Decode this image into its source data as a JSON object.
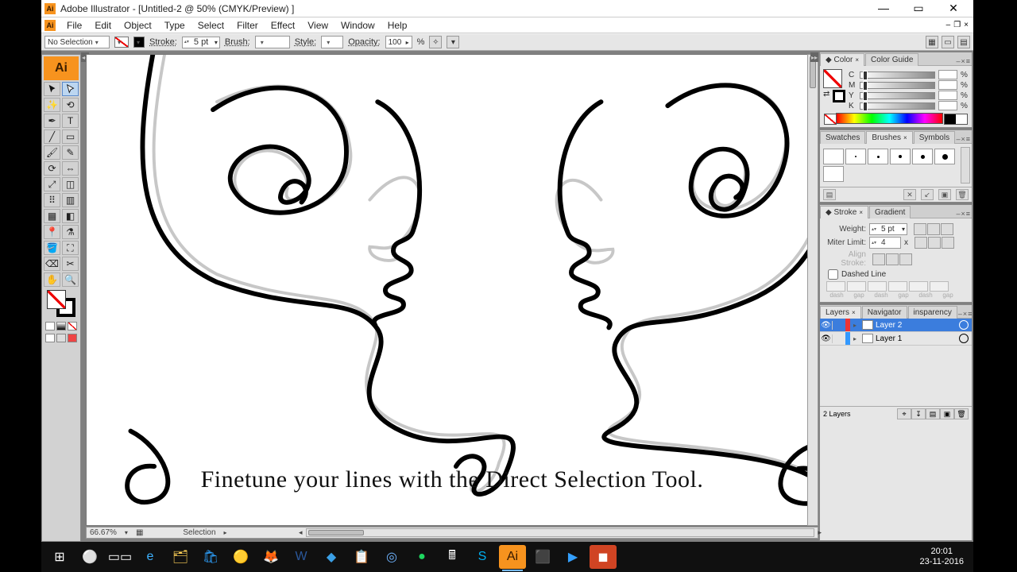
{
  "title": "Adobe Illustrator - [Untitled-2 @ 50% (CMYK/Preview) ]",
  "menu": [
    "File",
    "Edit",
    "Object",
    "Type",
    "Select",
    "Filter",
    "Effect",
    "View",
    "Window",
    "Help"
  ],
  "optbar": {
    "selection": "No Selection",
    "stroke_label": "Stroke:",
    "stroke_weight": "5 pt",
    "brush_label": "Brush:",
    "style_label": "Style:",
    "opacity_label": "Opacity:",
    "opacity": "100",
    "pct": "%"
  },
  "status": {
    "zoom": "66.67%",
    "tool": "Selection"
  },
  "caption": "Finetune  your lines with the Direct Selection Tool.",
  "panels": {
    "color": {
      "tab1": "Color",
      "tab2": "Color Guide",
      "labels": [
        "C",
        "M",
        "Y",
        "K"
      ],
      "pct": "%"
    },
    "swatches": {
      "tab1": "Swatches",
      "tab2": "Brushes",
      "tab3": "Symbols"
    },
    "stroke": {
      "tab1": "Stroke",
      "tab2": "Gradient",
      "weight_label": "Weight:",
      "weight": "5 pt",
      "miter_label": "Miter Limit:",
      "miter": "4",
      "miter_unit": "x",
      "align_label": "Align Stroke:",
      "dashed": "Dashed Line",
      "dashlabels": [
        "dash",
        "gap",
        "dash",
        "gap",
        "dash",
        "gap"
      ]
    },
    "layers": {
      "tab1": "Layers",
      "tab2": "Navigator",
      "tab3": "insparency",
      "layer2": "Layer 2",
      "layer1": "Layer 1",
      "count": "2 Layers"
    }
  },
  "clock": {
    "time": "20:01",
    "date": "23-11-2016"
  },
  "taskbar_icons": [
    "windows-icon",
    "search-icon",
    "task-view-icon",
    "edge-icon",
    "explorer-icon",
    "store-icon",
    "chrome-icon",
    "firefox-icon",
    "word-icon",
    "vscode-icon",
    "notepad-icon",
    "app-icon",
    "spotify-icon",
    "calculator-icon",
    "skype-icon",
    "illustrator-icon",
    "acrobat-icon",
    "media-icon",
    "powerpoint-icon"
  ]
}
